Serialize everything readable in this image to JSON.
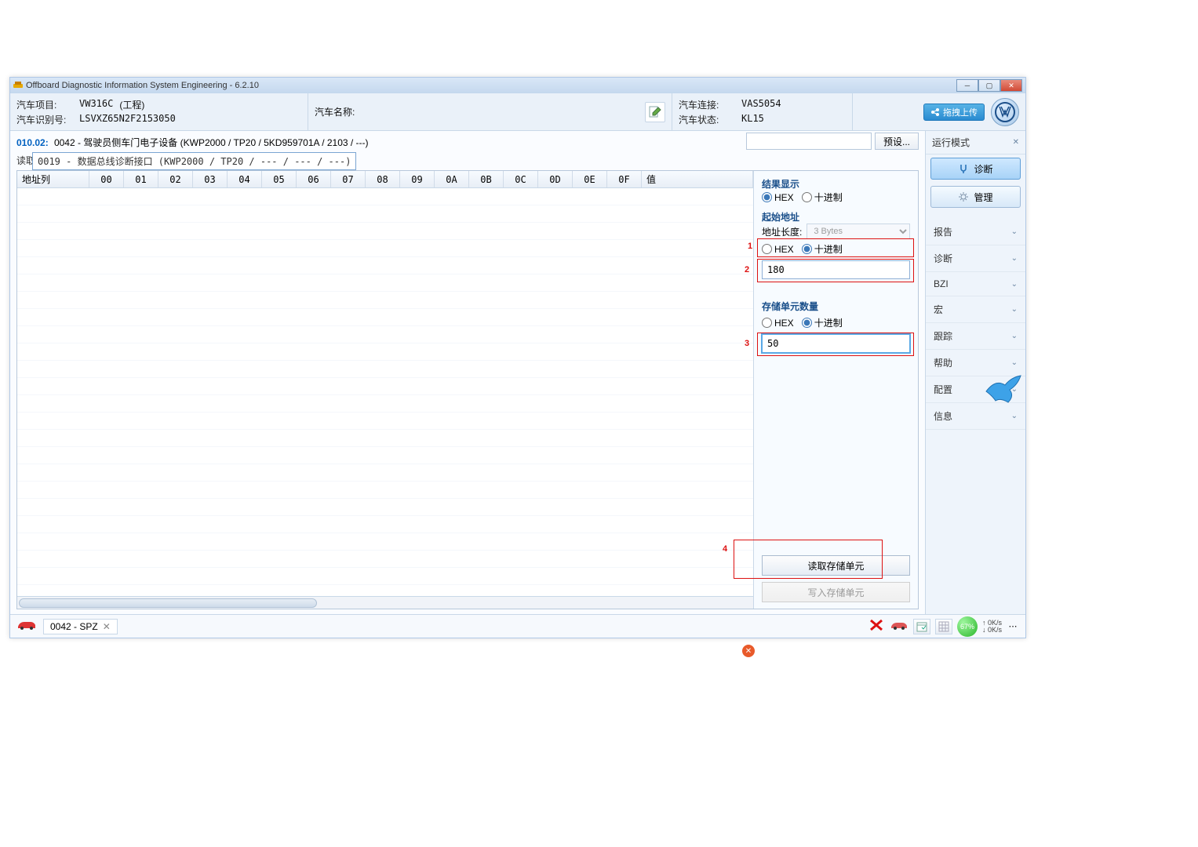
{
  "window": {
    "title": "Offboard Diagnostic Information System Engineering - 6.2.10"
  },
  "header": {
    "project_label": "汽车项目:",
    "project_value": "VW316C",
    "project_suffix": "(工程)",
    "vin_label": "汽车识别号:",
    "vin_value": "LSVXZ65N2F2153050",
    "name_label": "汽车名称:",
    "name_value": "",
    "conn_label": "汽车连接:",
    "conn_value": "VAS5054",
    "state_label": "汽车状态:",
    "state_value": "KL15",
    "upload_label": "拖拽上传"
  },
  "path": {
    "prefix": "010.02:",
    "text": "0042 - 驾驶员侧车门电子设备  (KWP2000 / TP20 / 5KD959701A   / 2103 / ---)",
    "preset_btn": "预设..."
  },
  "read": {
    "label_prefix": "读取",
    "overlay": "0019 - 数据总线诊断接口  (KWP2000 / TP20 / --- / --- / ---)"
  },
  "table": {
    "addr_col": "地址列",
    "hex_cols": [
      "00",
      "01",
      "02",
      "03",
      "04",
      "05",
      "06",
      "07",
      "08",
      "09",
      "0A",
      "0B",
      "0C",
      "0D",
      "0E",
      "0F"
    ],
    "val_col": "值"
  },
  "controls": {
    "result_title": "结果显示",
    "hex_label": "HEX",
    "dec_label": "十进制",
    "start_title": "起始地址",
    "addrlen_label": "地址长度:",
    "addrlen_value": "3 Bytes",
    "start_value": "180",
    "count_title": "存储单元数量",
    "count_value": "50",
    "read_btn": "读取存储单元",
    "write_btn": "写入存储单元"
  },
  "annotations": {
    "n1": "1",
    "n2": "2",
    "n3": "3",
    "n4": "4"
  },
  "rightnav": {
    "mode_title": "运行模式",
    "diag_btn": "诊断",
    "manage_btn": "管理",
    "items": [
      "报告",
      "诊断",
      "BZI",
      "宏",
      "跟踪",
      "帮助",
      "配置",
      "信息"
    ]
  },
  "bottom": {
    "tab_label": "0042 - SPZ",
    "percent": "67%",
    "rate_up": "0K/s",
    "rate_down": "0K/s"
  }
}
